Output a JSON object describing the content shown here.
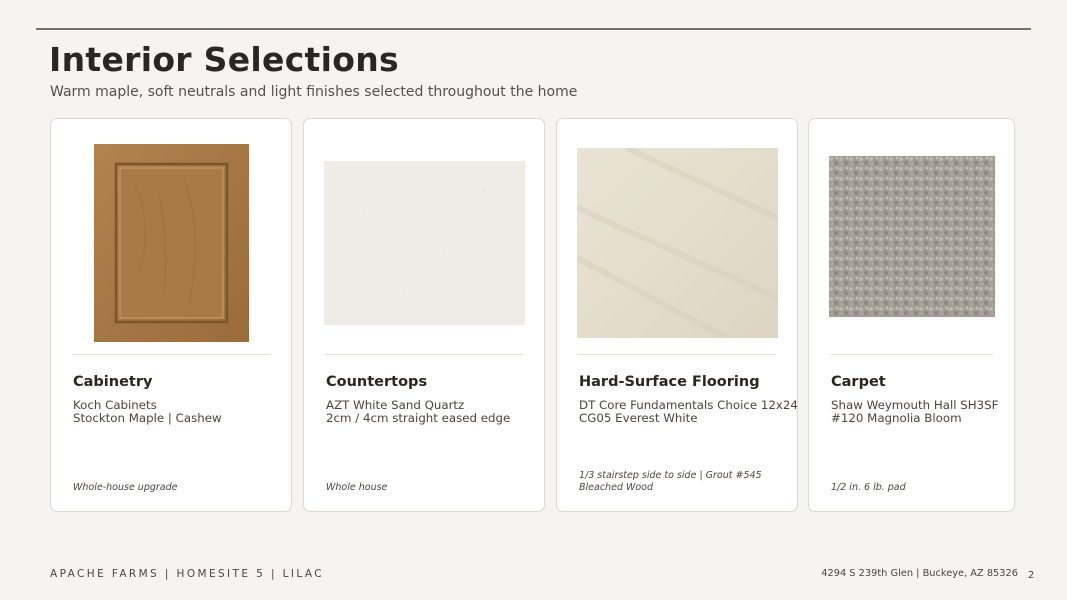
{
  "header": {
    "title": "Interior Selections",
    "subtitle": "Warm maple, soft neutrals and light finishes selected throughout the home"
  },
  "cards": [
    {
      "heading": "Cabinetry",
      "line1": "Koch Cabinets",
      "line2": "Stockton Maple  |  Cashew",
      "note1": "Whole-house upgrade",
      "note2": "",
      "swatch": "maple-cabinet-door"
    },
    {
      "heading": "Countertops",
      "line1": "AZT White Sand Quartz",
      "line2": "2cm / 4cm straight eased edge",
      "note1": "Whole house",
      "note2": "",
      "swatch": "white-quartz-slab"
    },
    {
      "heading": "Hard-Surface Flooring",
      "line1": "DT Core Fundamentals Choice 12x24",
      "line2": "CG05 Everest White",
      "note1": "1/3 stairstep side to side  |  Grout #545",
      "note2": "Bleached Wood",
      "swatch": "tile-sample"
    },
    {
      "heading": "Carpet",
      "line1": "Shaw Weymouth Hall SH3SF",
      "line2": "#120 Magnolia Bloom",
      "note1": "1/2 in. 6 lb. pad",
      "note2": "",
      "swatch": "carpet-sample"
    }
  ],
  "footer": {
    "community": "APACHE FARMS   |   HOMESITE 5   |   LILAC",
    "address": "4294 S 239th Glen  |  Buckeye, AZ 85326",
    "page": "2"
  },
  "colors": {
    "background": "#f6f4f0",
    "maple": "#a97a45",
    "quartz": "#efebe6",
    "tile": "#e6e0d1",
    "carpet": "#a39d95"
  }
}
